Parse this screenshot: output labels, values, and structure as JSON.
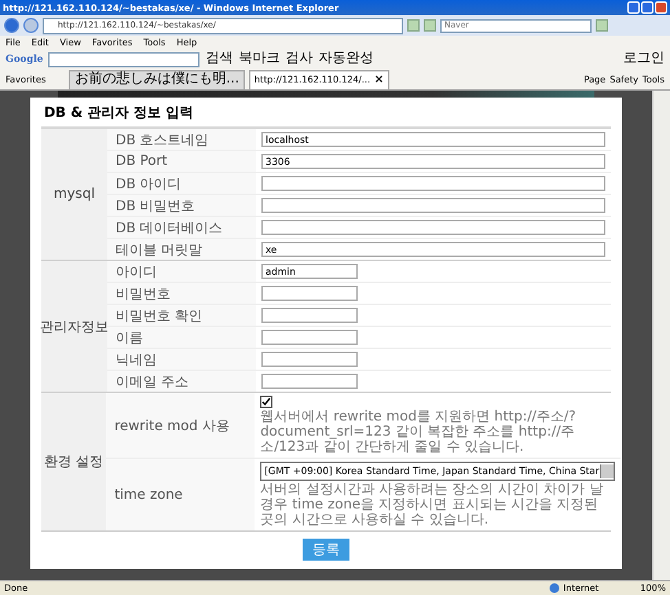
{
  "window": {
    "title": "http://121.162.110.124/~bestakas/xe/ - Windows Internet Explorer"
  },
  "address_bar": {
    "url": "http://121.162.110.124/~bestakas/xe/"
  },
  "search": {
    "placeholder": "Naver"
  },
  "menu": [
    "File",
    "Edit",
    "View",
    "Favorites",
    "Tools",
    "Help"
  ],
  "google_toolbar": {
    "brand": "Google",
    "items": [
      "검색",
      "북마크",
      "검사",
      "자동완성"
    ],
    "login": "로그인"
  },
  "favorites_bar": {
    "label": "Favorites",
    "tabs": [
      {
        "title": "お前の悲しみは僕にも明...",
        "selected": false
      },
      {
        "title": "http://121.162.110.124/...",
        "selected": true
      }
    ],
    "close": "×",
    "commands": [
      "Page",
      "Safety",
      "Tools"
    ]
  },
  "page": {
    "heading": "DB & 관리자 정보 입력",
    "sections": [
      {
        "label": "mysql",
        "rows": [
          {
            "label": "DB 호스트네임",
            "kind": "text",
            "value": "localhost"
          },
          {
            "label": "DB Port",
            "kind": "text",
            "value": "3306"
          },
          {
            "label": "DB 아이디",
            "kind": "text"
          },
          {
            "label": "DB 비밀번호",
            "kind": "text"
          },
          {
            "label": "DB 데이터베이스",
            "kind": "text"
          },
          {
            "label": "테이블 머릿말",
            "kind": "text",
            "value": "xe"
          }
        ]
      },
      {
        "label": "관리자정보",
        "rows": [
          {
            "label": "아이디",
            "kind": "short",
            "value": "admin"
          },
          {
            "label": "비밀번호",
            "kind": "short"
          },
          {
            "label": "비밀번호 확인",
            "kind": "short"
          },
          {
            "label": "이름",
            "kind": "short"
          },
          {
            "label": "닉네임",
            "kind": "short"
          },
          {
            "label": "이메일 주소",
            "kind": "short"
          }
        ]
      },
      {
        "label": "환경 설정",
        "rows": [
          {
            "label": "rewrite mod 사용",
            "kind": "checkbox",
            "checked": true,
            "description": "웹서버에서 rewrite mod를 지원하면 http://주소/?document_srl=123 같이 복잡한 주소를 http://주소/123과 같이 간단하게 줄일 수 있습니다."
          },
          {
            "label": "time zone",
            "kind": "select",
            "value": "[GMT +09:00] Korea Standard Time, Japan Standard Time, China Star",
            "description": "서버의 설정시간과 사용하려는 장소의 시간이 차이가 날 경우 time zone을 지정하시면 표시되는 시간을 지정된 곳의 시간으로 사용하실 수 있습니다."
          }
        ]
      }
    ],
    "submit": "등록"
  },
  "status_bar": {
    "text": "Done",
    "zone": "Internet",
    "zoom": "100%"
  }
}
